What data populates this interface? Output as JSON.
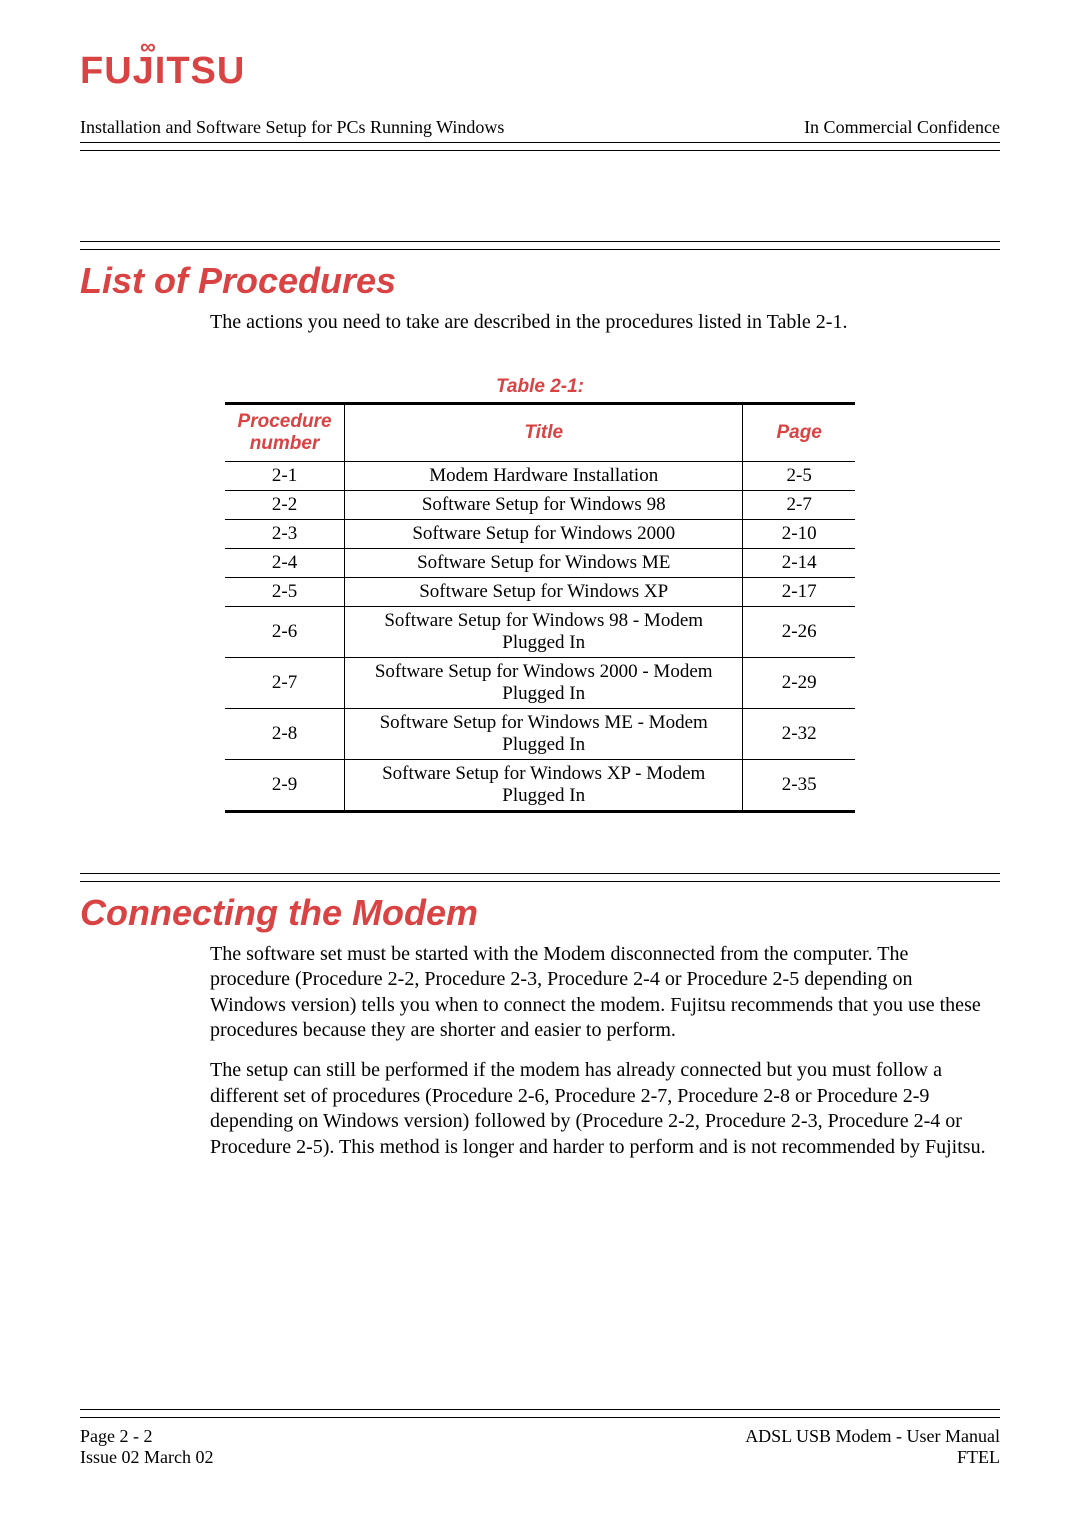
{
  "logo_text": "FUJITSU",
  "logo_symbol": "∞",
  "header": {
    "left": "Installation and Software Setup for PCs Running Windows",
    "right": "In Commercial Confidence"
  },
  "section1": {
    "heading": "List of Procedures",
    "intro": "The actions you need to take are described in the procedures listed in Table 2-1.",
    "table_caption": "Table 2-1:",
    "table_headers": {
      "col1a": "Procedure",
      "col1b": "number",
      "col2": "Title",
      "col3": "Page"
    },
    "rows": [
      {
        "num": "2-1",
        "title": "Modem Hardware Installation",
        "page": "2-5"
      },
      {
        "num": "2-2",
        "title": "Software Setup for Windows 98",
        "page": "2-7"
      },
      {
        "num": "2-3",
        "title": "Software Setup for Windows 2000",
        "page": "2-10"
      },
      {
        "num": "2-4",
        "title": "Software Setup for Windows ME",
        "page": "2-14"
      },
      {
        "num": "2-5",
        "title": "Software Setup for Windows XP",
        "page": "2-17"
      },
      {
        "num": "2-6",
        "title": "Software Setup for Windows 98 - Modem Plugged In",
        "page": "2-26"
      },
      {
        "num": "2-7",
        "title": "Software Setup for Windows 2000 -  Modem Plugged In",
        "page": "2-29"
      },
      {
        "num": "2-8",
        "title": "Software Setup for Windows ME - Modem Plugged In",
        "page": "2-32"
      },
      {
        "num": "2-9",
        "title": "Software Setup for Windows XP - Modem Plugged In",
        "page": "2-35"
      }
    ]
  },
  "section2": {
    "heading": "Connecting the Modem",
    "p1": "The software set must be started with the Modem disconnected from the computer. The procedure (Procedure 2-2, Procedure 2-3, Procedure 2-4 or Procedure 2-5 depending on Windows version) tells you when to connect the modem. Fujitsu recommends that you use these procedures because they are shorter and easier to perform.",
    "p2": "The setup can still be performed if the modem has already connected but you must follow a different set of procedures (Procedure 2-6, Procedure 2-7, Procedure 2-8 or Procedure 2-9 depending on Windows version) followed by (Procedure 2-2, Procedure 2-3, Procedure 2-4 or Procedure 2-5). This method is longer and harder to perform and is not recommended by Fujitsu."
  },
  "footer": {
    "left1": "Page 2 - 2",
    "right1": "ADSL USB Modem - User Manual",
    "left2": "Issue 02 March 02",
    "right2": "FTEL"
  }
}
